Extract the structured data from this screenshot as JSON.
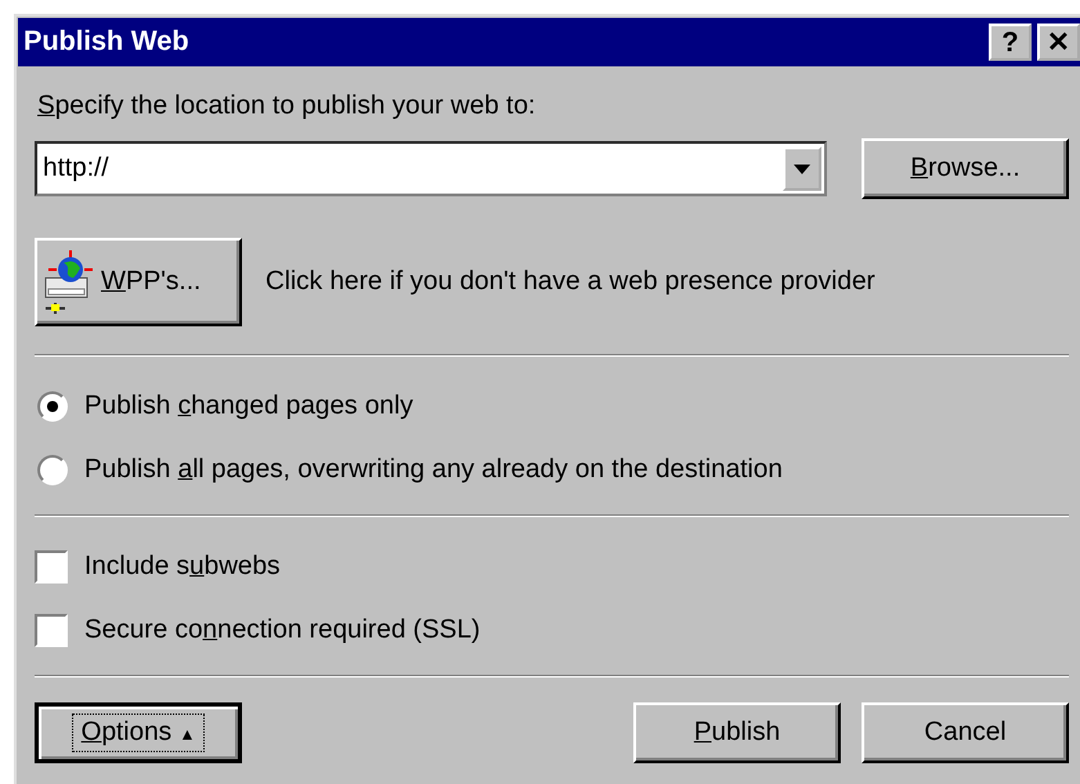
{
  "window": {
    "title": "Publish Web",
    "title_buttons": [
      {
        "kind": "help",
        "glyph": "?"
      },
      {
        "kind": "close",
        "glyph": "✕"
      }
    ]
  },
  "location": {
    "label": {
      "key": "S",
      "after": "pecify the location to publish your web to:"
    },
    "value": "http://",
    "browse": {
      "key": "B",
      "after": "rowse..."
    }
  },
  "wpp": {
    "button": {
      "key": "W",
      "after": "PP's..."
    },
    "text": "Click here if you don't have a web presence provider"
  },
  "publish_mode": [
    {
      "label": {
        "before": "Publish ",
        "key": "c",
        "after": "hanged pages only"
      },
      "selected": true
    },
    {
      "label": {
        "before": "Publish ",
        "key": "a",
        "after": "ll pages, overwriting any already on the destination"
      },
      "selected": false
    }
  ],
  "checkboxes": [
    {
      "label": {
        "before": "Include s",
        "key": "u",
        "after": "bwebs"
      },
      "checked": false
    },
    {
      "label": {
        "before": "Secure co",
        "key": "n",
        "after": "nection required (SSL)"
      },
      "checked": false
    }
  ],
  "buttons": [
    {
      "kind": "options",
      "label": {
        "key": "O",
        "after": "ptions"
      },
      "arrow": "▲",
      "focused": true
    },
    {
      "kind": "action",
      "label": {
        "key": "P",
        "after": "ublish"
      },
      "focused": false
    },
    {
      "kind": "action",
      "label": {
        "after": "Cancel"
      },
      "focused": false
    }
  ]
}
